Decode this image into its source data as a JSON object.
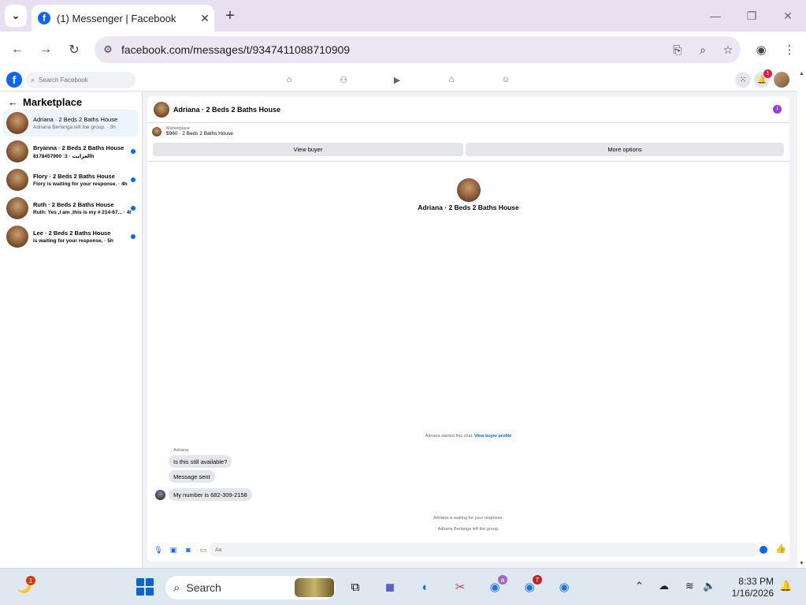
{
  "browser": {
    "tab_title": "(1) Messenger | Facebook",
    "url": "facebook.com/messages/t/9347411088710909"
  },
  "fb": {
    "search_placeholder": "Search Facebook",
    "notification_count": "1"
  },
  "sidebar": {
    "title": "Marketplace",
    "conversations": [
      {
        "name": "Adriana · 2 Beds 2 Baths House",
        "preview": "Adriana Berlanga left the group. · 3h",
        "unread": false
      },
      {
        "name": "Bryanna · 2 Beds 2 Baths House",
        "preview": "8178457900 :العرابت · 3h",
        "unread": true
      },
      {
        "name": "Flory · 2 Beds 2 Baths House",
        "preview": "Flory is waiting for your response. · 4h",
        "unread": true
      },
      {
        "name": "Ruth · 2 Beds 2 Baths House",
        "preview": "Ruth: Yes ,I am ,this is my # 214-67... · 4h",
        "unread": true
      },
      {
        "name": "Lee · 2 Beds 2 Baths House",
        "preview": "is waiting for your response. · 5h",
        "unread": true
      }
    ]
  },
  "chat": {
    "header_name": "Adriana · 2 Beds 2 Baths House",
    "listing_label": "Marketplace",
    "listing_price": "$960 · 2 Beds 2 Baths House",
    "view_buyer": "View buyer",
    "more_options": "More options",
    "center_name": "Adriana · 2 Beds 2 Baths House",
    "started_text": "Adriana started this chat.",
    "view_profile": "View buyer profile",
    "sender_label": "Adriana",
    "messages": [
      {
        "text": "Is this still available?"
      },
      {
        "text": "Message sent"
      },
      {
        "text": "My number is 682-309-2158"
      }
    ],
    "waiting_text": "Adriana is waiting for your response.",
    "left_text": "Adriana Berlanga left the group.",
    "composer_placeholder": "Aa"
  },
  "taskbar": {
    "search_label": "Search",
    "badge_start": "1",
    "badge_chrome_a": "a",
    "badge_chrome_t": "T",
    "time": "8:33 PM",
    "date": "1/16/2026"
  },
  "colors": {
    "fb_blue": "#0866ff",
    "unread_dot": "#0866ff",
    "info_purple": "#a033ff",
    "notification_red": "#e41e3f"
  }
}
